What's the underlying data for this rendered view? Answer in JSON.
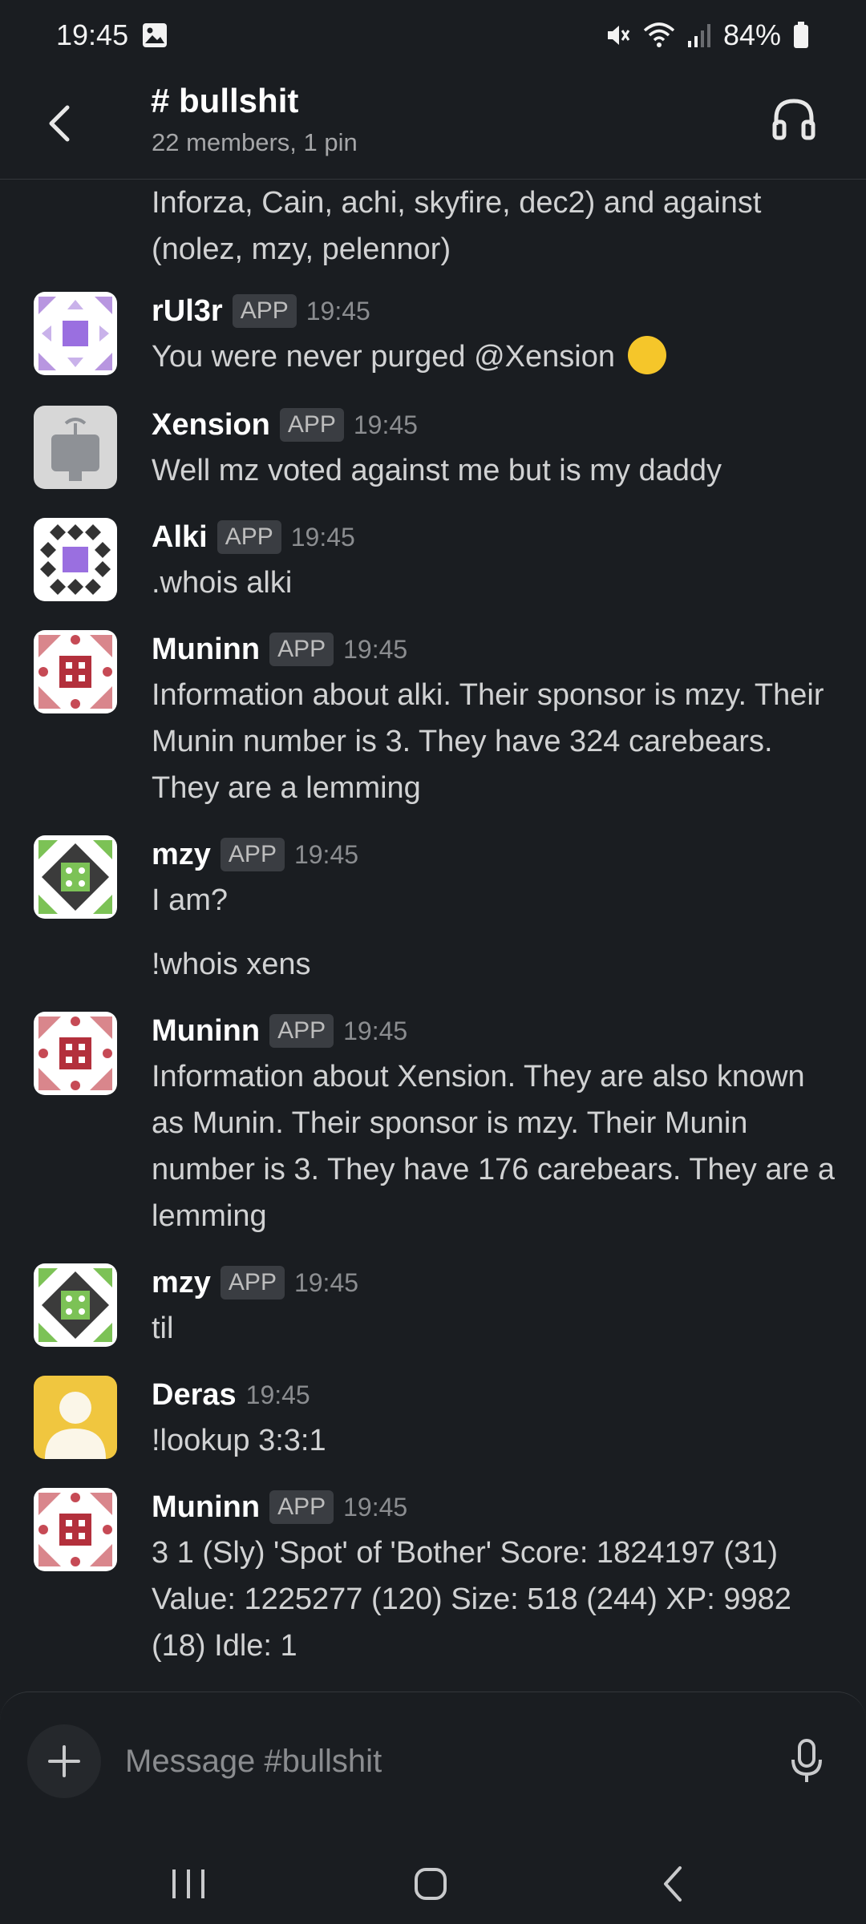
{
  "status_bar": {
    "time": "19:45",
    "battery": "84%",
    "icons": [
      "gallery-icon",
      "mute-icon",
      "wifi-icon",
      "signal-icon",
      "battery-icon"
    ]
  },
  "header": {
    "channel": "# bullshit",
    "subtitle": "22 members, 1 pin"
  },
  "continuation": {
    "text": "Inforza, Cain, achi, skyfire, dec2) and against (nolez, mzy, pelennor)"
  },
  "messages": [
    {
      "author": "rUl3r",
      "badge": "APP",
      "time": "19:45",
      "text": "You were never purged @Xension",
      "emoji": "sweat-smile-emoji"
    },
    {
      "author": "Xension",
      "badge": "APP",
      "time": "19:45",
      "text": "Well mz voted against me but is my daddy"
    },
    {
      "author": "Alki",
      "badge": "APP",
      "time": "19:45",
      "text": ".whois alki"
    },
    {
      "author": "Muninn",
      "badge": "APP",
      "time": "19:45",
      "text": "Information about alki.  Their sponsor is mzy. Their Munin number is 3. They have 324 carebears. They are a lemming"
    },
    {
      "author": "mzy",
      "badge": "APP",
      "time": "19:45",
      "text": "I am?",
      "followup": "!whois xens"
    },
    {
      "author": "Muninn",
      "badge": "APP",
      "time": "19:45",
      "text": "Information about Xension. They are also known as Munin. Their sponsor is mzy. Their Munin number is 3. They have 176 carebears. They are a lemming"
    },
    {
      "author": "mzy",
      "badge": "APP",
      "time": "19:45",
      "text": "til"
    },
    {
      "author": "Deras",
      "time": "19:45",
      "text": "!lookup 3:3:1"
    },
    {
      "author": "Muninn",
      "badge": "APP",
      "time": "19:45",
      "text": "3 1 (Sly) 'Spot' of 'Bother' Score: 1824197 (31) Value: 1225277 (120) Size: 518 (244) XP: 9982 (18) Idle: 1"
    }
  ],
  "composer": {
    "placeholder": "Message #bullshit"
  },
  "colors": {
    "background": "#1a1d21",
    "text": "#d1d2d3",
    "author": "#ffffff",
    "badge_bg": "#3a3d42",
    "muted": "#8b8d90"
  }
}
